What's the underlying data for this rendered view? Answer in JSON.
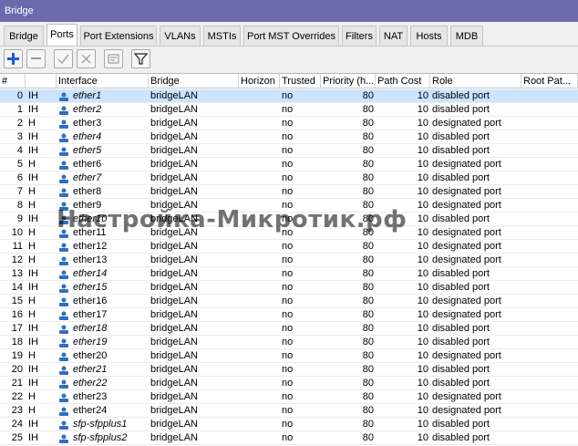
{
  "window": {
    "title": "Bridge"
  },
  "tabs": [
    {
      "label": "Bridge"
    },
    {
      "label": "Ports"
    },
    {
      "label": "Port Extensions"
    },
    {
      "label": "VLANs"
    },
    {
      "label": "MSTIs"
    },
    {
      "label": "Port MST Overrides"
    },
    {
      "label": "Filters"
    },
    {
      "label": "NAT"
    },
    {
      "label": "Hosts"
    },
    {
      "label": "MDB"
    }
  ],
  "active_tab": "Ports",
  "toolbar": {
    "buttons": [
      "add-icon",
      "remove-icon",
      "enable-icon",
      "disable-icon",
      "comment-icon",
      "filter-icon"
    ]
  },
  "table": {
    "columns": [
      "#",
      "",
      "Interface",
      "Bridge",
      "Horizon",
      "Trusted",
      "Priority (h...",
      "Path Cost",
      "Role",
      "Root Pat..."
    ],
    "rows": [
      {
        "n": "0",
        "flags": "IH",
        "iface": "ether1",
        "italic": true,
        "bridge": "bridgeLAN",
        "horizon": "",
        "trusted": "no",
        "priority": "80",
        "cost": "10",
        "role": "disabled port"
      },
      {
        "n": "1",
        "flags": "IH",
        "iface": "ether2",
        "italic": true,
        "bridge": "bridgeLAN",
        "horizon": "",
        "trusted": "no",
        "priority": "80",
        "cost": "10",
        "role": "disabled port"
      },
      {
        "n": "2",
        "flags": "H",
        "iface": "ether3",
        "italic": false,
        "bridge": "bridgeLAN",
        "horizon": "",
        "trusted": "no",
        "priority": "80",
        "cost": "10",
        "role": "designated port"
      },
      {
        "n": "3",
        "flags": "IH",
        "iface": "ether4",
        "italic": true,
        "bridge": "bridgeLAN",
        "horizon": "",
        "trusted": "no",
        "priority": "80",
        "cost": "10",
        "role": "disabled port"
      },
      {
        "n": "4",
        "flags": "IH",
        "iface": "ether5",
        "italic": true,
        "bridge": "bridgeLAN",
        "horizon": "",
        "trusted": "no",
        "priority": "80",
        "cost": "10",
        "role": "disabled port"
      },
      {
        "n": "5",
        "flags": "H",
        "iface": "ether6",
        "italic": false,
        "bridge": "bridgeLAN",
        "horizon": "",
        "trusted": "no",
        "priority": "80",
        "cost": "10",
        "role": "designated port"
      },
      {
        "n": "6",
        "flags": "IH",
        "iface": "ether7",
        "italic": true,
        "bridge": "bridgeLAN",
        "horizon": "",
        "trusted": "no",
        "priority": "80",
        "cost": "10",
        "role": "disabled port"
      },
      {
        "n": "7",
        "flags": "H",
        "iface": "ether8",
        "italic": false,
        "bridge": "bridgeLAN",
        "horizon": "",
        "trusted": "no",
        "priority": "80",
        "cost": "10",
        "role": "designated port"
      },
      {
        "n": "8",
        "flags": "H",
        "iface": "ether9",
        "italic": false,
        "bridge": "bridgeLAN",
        "horizon": "",
        "trusted": "no",
        "priority": "80",
        "cost": "10",
        "role": "designated port"
      },
      {
        "n": "9",
        "flags": "IH",
        "iface": "ether10",
        "italic": true,
        "bridge": "bridgeLAN",
        "horizon": "",
        "trusted": "no",
        "priority": "80",
        "cost": "10",
        "role": "disabled port"
      },
      {
        "n": "10",
        "flags": "H",
        "iface": "ether11",
        "italic": false,
        "bridge": "bridgeLAN",
        "horizon": "",
        "trusted": "no",
        "priority": "80",
        "cost": "10",
        "role": "designated port"
      },
      {
        "n": "11",
        "flags": "H",
        "iface": "ether12",
        "italic": false,
        "bridge": "bridgeLAN",
        "horizon": "",
        "trusted": "no",
        "priority": "80",
        "cost": "10",
        "role": "designated port"
      },
      {
        "n": "12",
        "flags": "H",
        "iface": "ether13",
        "italic": false,
        "bridge": "bridgeLAN",
        "horizon": "",
        "trusted": "no",
        "priority": "80",
        "cost": "10",
        "role": "designated port"
      },
      {
        "n": "13",
        "flags": "IH",
        "iface": "ether14",
        "italic": true,
        "bridge": "bridgeLAN",
        "horizon": "",
        "trusted": "no",
        "priority": "80",
        "cost": "10",
        "role": "disabled port"
      },
      {
        "n": "14",
        "flags": "IH",
        "iface": "ether15",
        "italic": true,
        "bridge": "bridgeLAN",
        "horizon": "",
        "trusted": "no",
        "priority": "80",
        "cost": "10",
        "role": "disabled port"
      },
      {
        "n": "15",
        "flags": "H",
        "iface": "ether16",
        "italic": false,
        "bridge": "bridgeLAN",
        "horizon": "",
        "trusted": "no",
        "priority": "80",
        "cost": "10",
        "role": "designated port"
      },
      {
        "n": "16",
        "flags": "H",
        "iface": "ether17",
        "italic": false,
        "bridge": "bridgeLAN",
        "horizon": "",
        "trusted": "no",
        "priority": "80",
        "cost": "10",
        "role": "designated port"
      },
      {
        "n": "17",
        "flags": "IH",
        "iface": "ether18",
        "italic": true,
        "bridge": "bridgeLAN",
        "horizon": "",
        "trusted": "no",
        "priority": "80",
        "cost": "10",
        "role": "disabled port"
      },
      {
        "n": "18",
        "flags": "IH",
        "iface": "ether19",
        "italic": true,
        "bridge": "bridgeLAN",
        "horizon": "",
        "trusted": "no",
        "priority": "80",
        "cost": "10",
        "role": "disabled port"
      },
      {
        "n": "19",
        "flags": "H",
        "iface": "ether20",
        "italic": false,
        "bridge": "bridgeLAN",
        "horizon": "",
        "trusted": "no",
        "priority": "80",
        "cost": "10",
        "role": "designated port"
      },
      {
        "n": "20",
        "flags": "IH",
        "iface": "ether21",
        "italic": true,
        "bridge": "bridgeLAN",
        "horizon": "",
        "trusted": "no",
        "priority": "80",
        "cost": "10",
        "role": "disabled port"
      },
      {
        "n": "21",
        "flags": "IH",
        "iface": "ether22",
        "italic": true,
        "bridge": "bridgeLAN",
        "horizon": "",
        "trusted": "no",
        "priority": "80",
        "cost": "10",
        "role": "disabled port"
      },
      {
        "n": "22",
        "flags": "H",
        "iface": "ether23",
        "italic": false,
        "bridge": "bridgeLAN",
        "horizon": "",
        "trusted": "no",
        "priority": "80",
        "cost": "10",
        "role": "designated port"
      },
      {
        "n": "23",
        "flags": "H",
        "iface": "ether24",
        "italic": false,
        "bridge": "bridgeLAN",
        "horizon": "",
        "trusted": "no",
        "priority": "80",
        "cost": "10",
        "role": "designated port"
      },
      {
        "n": "24",
        "flags": "IH",
        "iface": "sfp-sfpplus1",
        "italic": true,
        "bridge": "bridgeLAN",
        "horizon": "",
        "trusted": "no",
        "priority": "80",
        "cost": "10",
        "role": "disabled port"
      },
      {
        "n": "25",
        "flags": "IH",
        "iface": "sfp-sfpplus2",
        "italic": true,
        "bridge": "bridgeLAN",
        "horizon": "",
        "trusted": "no",
        "priority": "80",
        "cost": "10",
        "role": "disabled port"
      }
    ],
    "selected_row": 0
  },
  "watermark": "Настройка-Микротик.рф",
  "colors": {
    "title_bar": "#6a6aad",
    "selection": "#cce4ff",
    "icon_blue": "#2f6fc0"
  }
}
